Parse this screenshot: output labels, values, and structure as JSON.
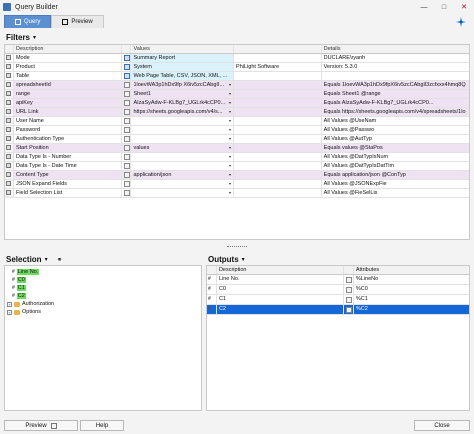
{
  "window": {
    "title": "Query Builder"
  },
  "tabs": [
    {
      "label": "Query"
    },
    {
      "label": "Preview"
    }
  ],
  "filters": {
    "title": "Filters",
    "dropdown_glyph": "▾",
    "columns": {
      "description": "Description",
      "values": "Values",
      "details": "Details"
    },
    "rows": [
      {
        "description": "Mode",
        "value": "Summary Report",
        "details": "DUCLARE\\ryanh",
        "style": "blue"
      },
      {
        "description": "Product",
        "value": "System",
        "value2": "PhiLight Software",
        "details": "Version: 5.3.0",
        "style": "blue"
      },
      {
        "description": "Table",
        "value": "Web Page Table, CSV, JSON, XML, ...",
        "details": "",
        "style": "blue"
      },
      {
        "description": "spreadsheetId",
        "value": "1loevWA3p1hDx9fp X6iv5zcCAbgII...",
        "details": "Equals 1loevWA3p1hDx9fpX6iv5zcCAbgIl3zcfxxx4hmq8Q",
        "style": "purple"
      },
      {
        "description": "range",
        "value": "Sheet1",
        "details": "Equals Sheet1 @range",
        "style": "purple"
      },
      {
        "description": "apiKey",
        "value": "AIzaSyAdw-F-KLBg7_UGLrk4cCP0...",
        "details": "Equals AIzaSyAdw-F-KLBg7_UGLrk4cCP0...",
        "style": "purple"
      },
      {
        "description": "URL Link",
        "value": "https://sheets.googleapis.com/v4/s...",
        "details": "Equals https://sheets.googleapis.com/v4/spreadsheets/1lo",
        "style": "purple"
      },
      {
        "description": "User Name",
        "value": "",
        "details": "All Values @UseNam",
        "style": "white"
      },
      {
        "description": "Password",
        "value": "",
        "details": "All Values @Passwo",
        "style": "white"
      },
      {
        "description": "Authentication Type",
        "value": "",
        "details": "All Values @AutTyp",
        "style": "white"
      },
      {
        "description": "Start Position",
        "value": "values",
        "details": "Equals values @StaPos",
        "style": "purple"
      },
      {
        "description": "Data Type Is - Number",
        "value": "",
        "details": "All Values @DatTypIsNum",
        "style": "white"
      },
      {
        "description": "Data Type Is - Date Time",
        "value": "",
        "details": "All Values @DatTypIsDatTim",
        "style": "white"
      },
      {
        "description": "Content Type",
        "value": "application/json",
        "details": "Equals application/json @ConTyp",
        "style": "purple"
      },
      {
        "description": "JSON Expand Fields",
        "value": "",
        "details": "All Values @JSONExpFie",
        "style": "white"
      },
      {
        "description": "Field Selection List",
        "value": "",
        "details": "All Values @FieSelLis",
        "style": "white"
      }
    ]
  },
  "selection": {
    "title": "Selection",
    "dropdown_glyph": "▾",
    "tree": [
      {
        "label": "Line No.",
        "type": "field",
        "level": 1,
        "highlight": true
      },
      {
        "label": "C0",
        "type": "field",
        "level": 1,
        "highlight": true
      },
      {
        "label": "C1",
        "type": "field",
        "level": 1,
        "highlight": true
      },
      {
        "label": "C2",
        "type": "field",
        "level": 1,
        "highlight": true
      },
      {
        "label": "Authorization",
        "type": "folder",
        "level": 0,
        "highlight": false
      },
      {
        "label": "Options",
        "type": "folder",
        "level": 0,
        "highlight": false
      }
    ]
  },
  "outputs": {
    "title": "Outputs",
    "dropdown_glyph": "▾",
    "columns": {
      "description": "Description",
      "attributes": "Attributes"
    },
    "rows": [
      {
        "description": "Line No.",
        "attribute": "%LineNo",
        "selected": false
      },
      {
        "description": "C0",
        "attribute": "%C0",
        "selected": false
      },
      {
        "description": "C1",
        "attribute": "%C1",
        "selected": false
      },
      {
        "description": "C2",
        "attribute": "%C2",
        "selected": true
      }
    ]
  },
  "buttons": {
    "preview": "Preview",
    "help": "Help",
    "close": "Close"
  },
  "colors": {
    "accent": "#1566d6",
    "purple_row": "#efe3f3",
    "blue_value": "#d9f2fb",
    "highlight": "#6ddb5e"
  }
}
